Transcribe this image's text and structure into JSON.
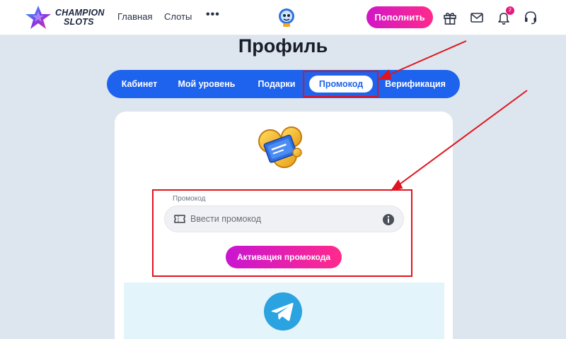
{
  "header": {
    "logo": {
      "line1": "CHAMPION",
      "line2": "SLOTS"
    },
    "nav": {
      "main": "Главная",
      "slots": "Слоты",
      "more": "•••"
    },
    "topup_label": "Пополнить",
    "notification_count": "2",
    "icons": [
      "gift-icon",
      "mail-icon",
      "bell-icon",
      "support-icon"
    ]
  },
  "page": {
    "title": "Профиль"
  },
  "tabs": {
    "cabinet": "Кабинет",
    "level": "Мой уровень",
    "gifts": "Подарки",
    "promo": "Промокод",
    "verification": "Верификация",
    "active": "Промокод"
  },
  "promo_form": {
    "field_label": "Промокод",
    "placeholder": "Ввести промокод",
    "value": "",
    "activate_label": "Активация промокода"
  },
  "colors": {
    "accent_blue": "#1d63ee",
    "button_gradient_start": "#c915d1",
    "button_gradient_end": "#ff2a8c",
    "highlight_red": "#e0141e",
    "background": "#dde6ee"
  }
}
